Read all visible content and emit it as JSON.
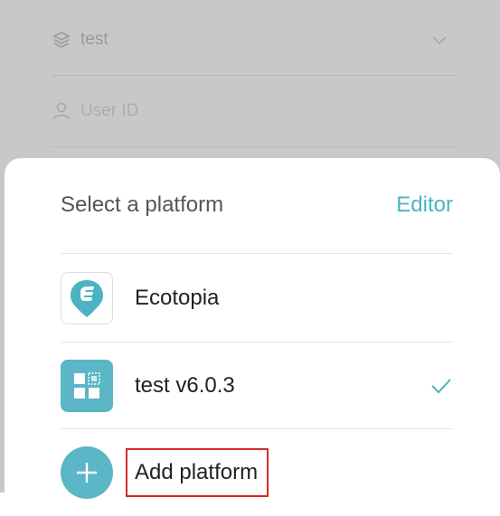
{
  "background_form": {
    "platform_value": "test",
    "user_id_placeholder": "User ID"
  },
  "sheet": {
    "title": "Select a platform",
    "editor_label": "Editor",
    "platforms": [
      {
        "label": "Ecotopia",
        "icon": "ecotopia-logo-icon",
        "selected": false
      },
      {
        "label": "test v6.0.3",
        "icon": "grid-app-icon",
        "selected": true
      }
    ],
    "add_label": "Add platform"
  },
  "colors": {
    "accent": "#4ab3c4",
    "highlight_border": "#d42a2a",
    "overlay": "#c8c8c8"
  }
}
